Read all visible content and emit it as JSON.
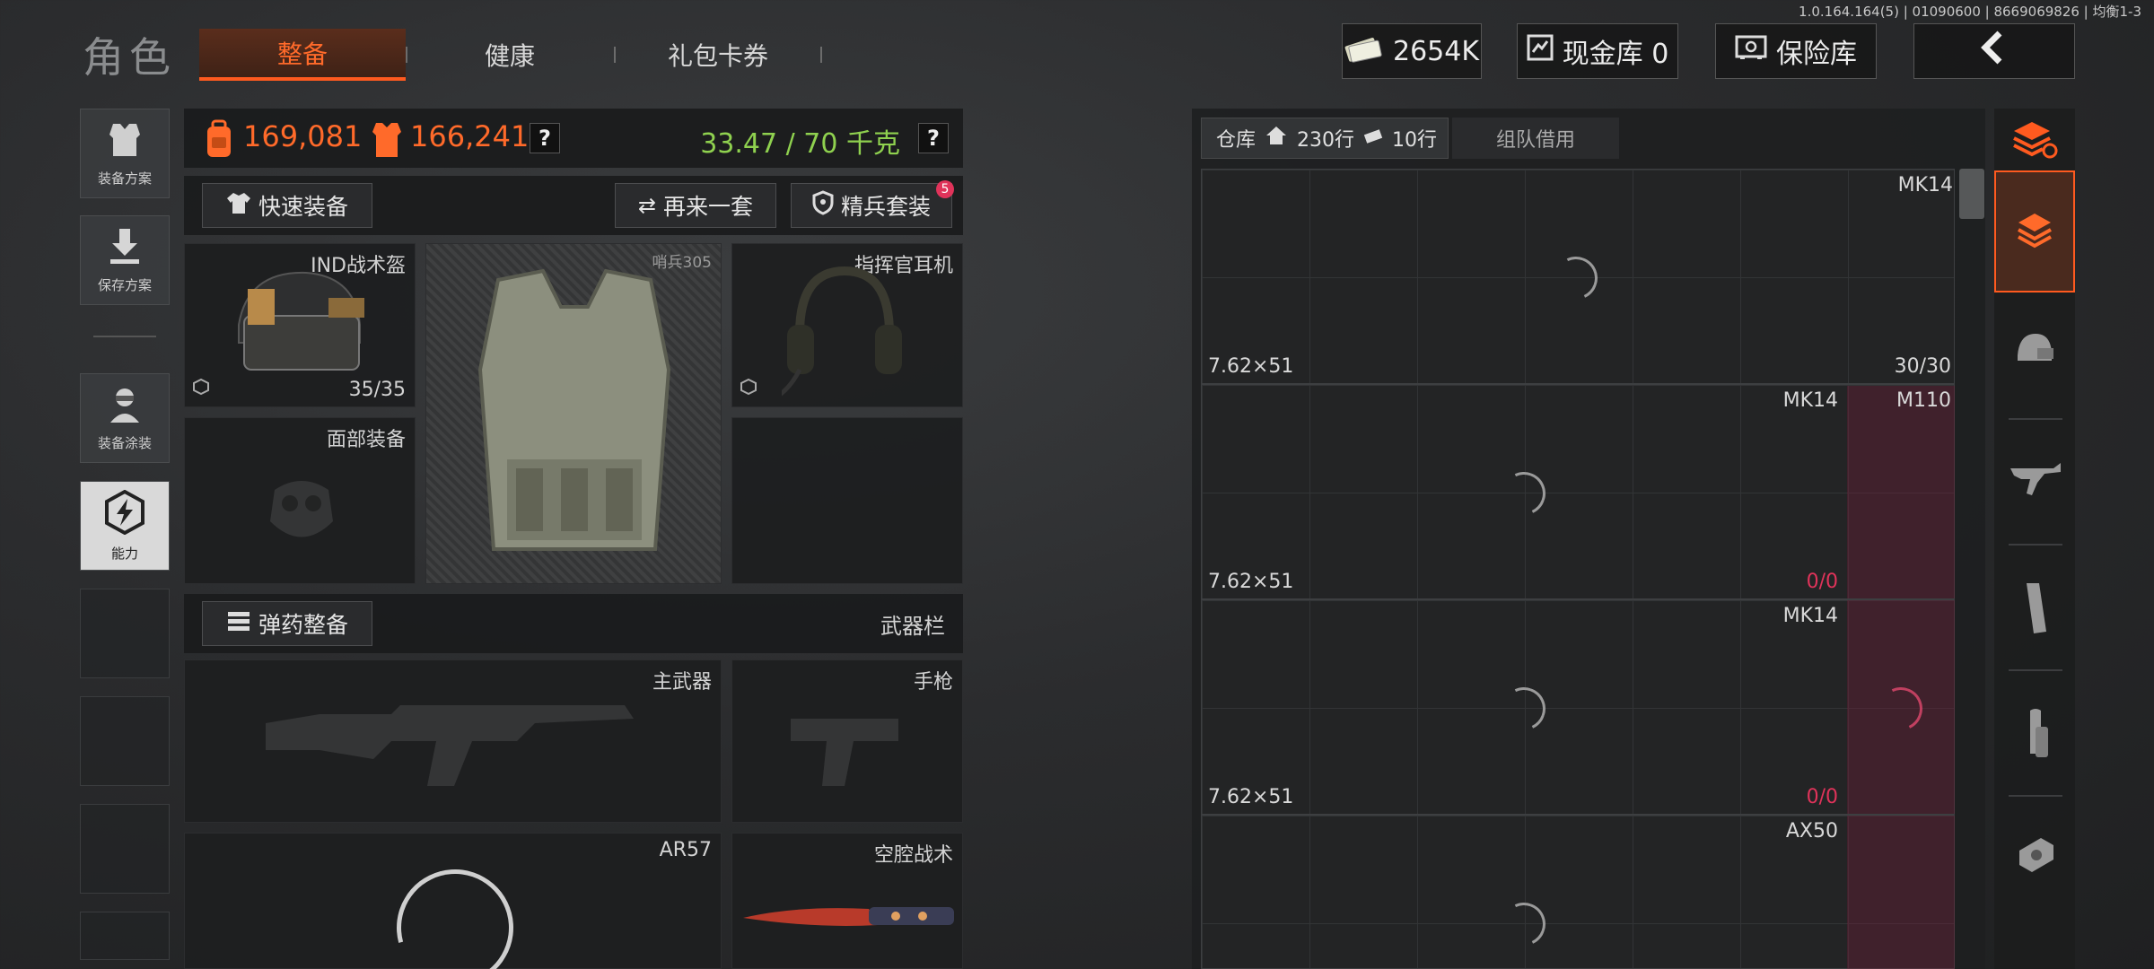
{
  "header": {
    "title": "角色",
    "version": "1.0.164.164(5) | 01090600 | 8669069826 | 均衡1-3",
    "tabs": [
      "整备",
      "健康",
      "礼包卡券"
    ],
    "currency": "2654K",
    "cash_vault": "现金库 0",
    "safe_box": "保险库"
  },
  "sidebar": {
    "items": [
      "装备方案",
      "保存方案",
      "装备涂装",
      "能力"
    ]
  },
  "stats": {
    "value_total": "169,081",
    "value_equipped": "166,241",
    "weight": "33.47 / 70 千克",
    "help": "?"
  },
  "actions": {
    "quick_equip": "快速装备",
    "again": "再来一套",
    "elite": "精兵套装",
    "elite_badge": "5"
  },
  "slots": {
    "helmet": {
      "label": "IND战术盔",
      "durability": "35/35"
    },
    "armor": {
      "label": "哨兵305"
    },
    "headset": {
      "label": "指挥官耳机"
    },
    "face": {
      "label": "面部装备"
    }
  },
  "weapons": {
    "ammo_button": "弹药整备",
    "section_label": "武器栏",
    "primary": "主武器",
    "pistol": "手枪",
    "secondary": "AR57",
    "melee": "空腔战术"
  },
  "warehouse": {
    "tab_label": "仓库",
    "capacity": "230行",
    "tickets": "10行",
    "team_borrow": "组队借用",
    "rows": [
      {
        "name": "MK14",
        "caliber": "7.62×51",
        "count": "30/30"
      },
      {
        "name": "MK14",
        "side_name": "M110",
        "caliber": "7.62×51",
        "count": "0/0"
      },
      {
        "name": "MK14",
        "caliber": "7.62×51",
        "count": "0/0"
      },
      {
        "name": "AX50"
      }
    ]
  },
  "colors": {
    "accent": "#ff5a1f",
    "weight_green": "#8fd14f",
    "value_orange": "#ff6a2a",
    "warning_pink": "#e0335a"
  }
}
